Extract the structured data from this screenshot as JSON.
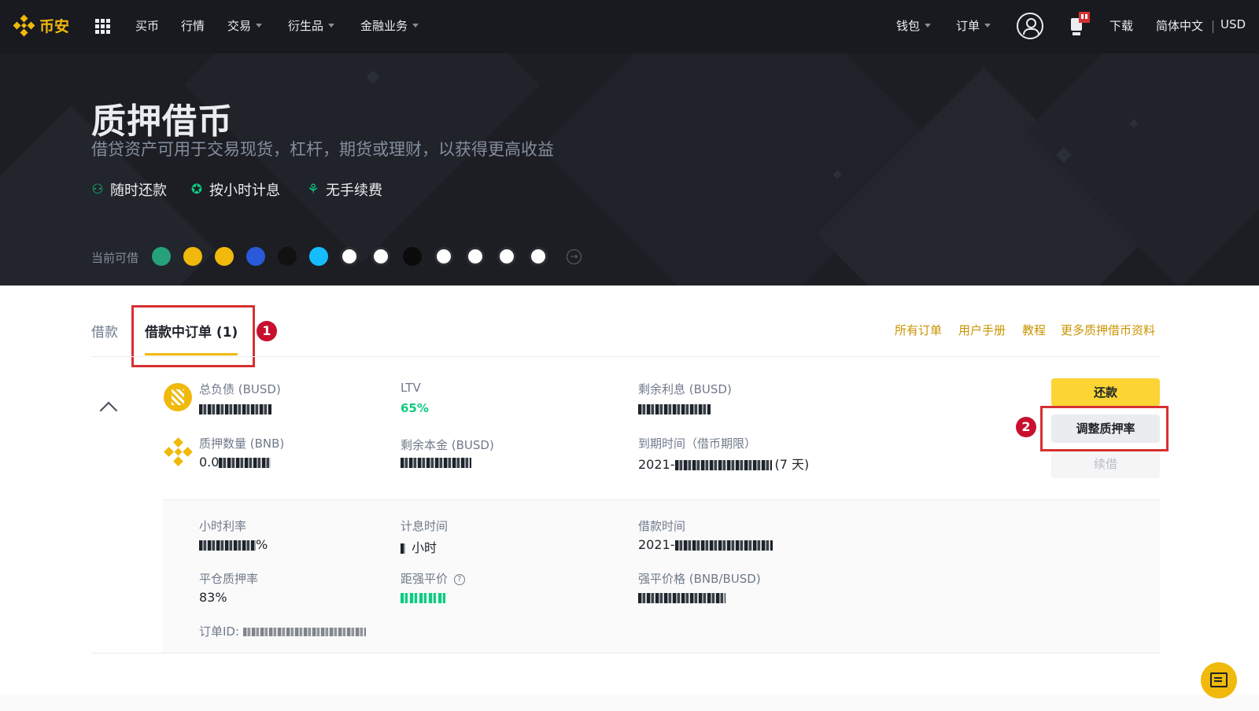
{
  "nav": {
    "brand": "币安",
    "items": [
      {
        "label": "买币",
        "has_dropdown": false
      },
      {
        "label": "行情",
        "has_dropdown": false
      },
      {
        "label": "交易",
        "has_dropdown": true
      },
      {
        "label": "衍生品",
        "has_dropdown": true
      },
      {
        "label": "金融业务",
        "has_dropdown": true
      }
    ],
    "right_items": [
      {
        "label": "钱包",
        "has_dropdown": true
      },
      {
        "label": "订单",
        "has_dropdown": true
      }
    ],
    "download": "下载",
    "language": "简体中文",
    "currency": "USD",
    "icons": [
      "apps-grid-icon",
      "user-icon",
      "notification-icon"
    ]
  },
  "hero": {
    "title": "质押借币",
    "subtitle": "借贷资产可用于交易现货，杠杆，期货或理财，以获得更高收益",
    "features": [
      {
        "icon": "medal-icon",
        "label": "随时还款"
      },
      {
        "icon": "check-badge-icon",
        "label": "按小时计息"
      },
      {
        "icon": "no-fee-icon",
        "label": "无手续费"
      }
    ],
    "coins_label": "当前可借",
    "coins": [
      {
        "name": "usdt-icon",
        "color": "#26a17b"
      },
      {
        "name": "busd-icon",
        "color": "#f0b90b"
      },
      {
        "name": "bnb-icon",
        "color": "#f0b90b"
      },
      {
        "name": "coin-blue-icon",
        "color": "#2a5ada"
      },
      {
        "name": "coin-dark-icon",
        "color": "#111111"
      },
      {
        "name": "vet-icon",
        "color": "#15bdff"
      },
      {
        "name": "coin-white-icon",
        "color": "#ffffff"
      },
      {
        "name": "coin-multicolor-icon",
        "color": "#ffffff"
      },
      {
        "name": "coin-green-dark-icon",
        "color": "#0b0b0b"
      },
      {
        "name": "eth-green-icon",
        "color": "#ffffff"
      },
      {
        "name": "coin-pink-icon",
        "color": "#ffffff"
      },
      {
        "name": "coin-orange-icon",
        "color": "#ffffff"
      },
      {
        "name": "coin-stellar-icon",
        "color": "#ffffff"
      }
    ]
  },
  "tabs": {
    "loan": "借款",
    "active_orders": "借款中订单 (1)"
  },
  "annotations": {
    "step1": "1",
    "step2": "2"
  },
  "links": [
    "所有订单",
    "用户手册",
    "教程",
    "更多质押借币资料"
  ],
  "order": {
    "total_debt_label": "总负债 (BUSD)",
    "ltv_label": "LTV",
    "ltv_value": "65%",
    "remaining_interest_label": "剩余利息 (BUSD)",
    "collateral_label": "质押数量 (BNB)",
    "collateral_value_prefix": "0.0",
    "remaining_principal_label": "剩余本金 (BUSD)",
    "expiry_label": "到期时间（借币期限）",
    "expiry_value_prefix": "2021-",
    "expiry_term": "(7 天)",
    "buttons": {
      "repay": "还款",
      "adjust_ltv": "调整质押率",
      "renew": "续借"
    }
  },
  "details": {
    "hourly_rate_label": "小时利率",
    "hourly_rate_suffix": "%",
    "interest_period_label": "计息时间",
    "interest_period_suffix": "小时",
    "loan_time_label": "借款时间",
    "loan_time_prefix": "2021-",
    "liquidation_ltv_label": "平仓质押率",
    "liquidation_ltv_value": "83%",
    "distance_to_liq_label": "距强平价",
    "liquidation_price_label": "强平价格 (BNB/BUSD)",
    "order_id_label": "订单ID:"
  },
  "colors": {
    "brand": "#f0b90b",
    "green": "#0ecb81",
    "link": "#c99400",
    "highlight_red": "#d63031"
  }
}
